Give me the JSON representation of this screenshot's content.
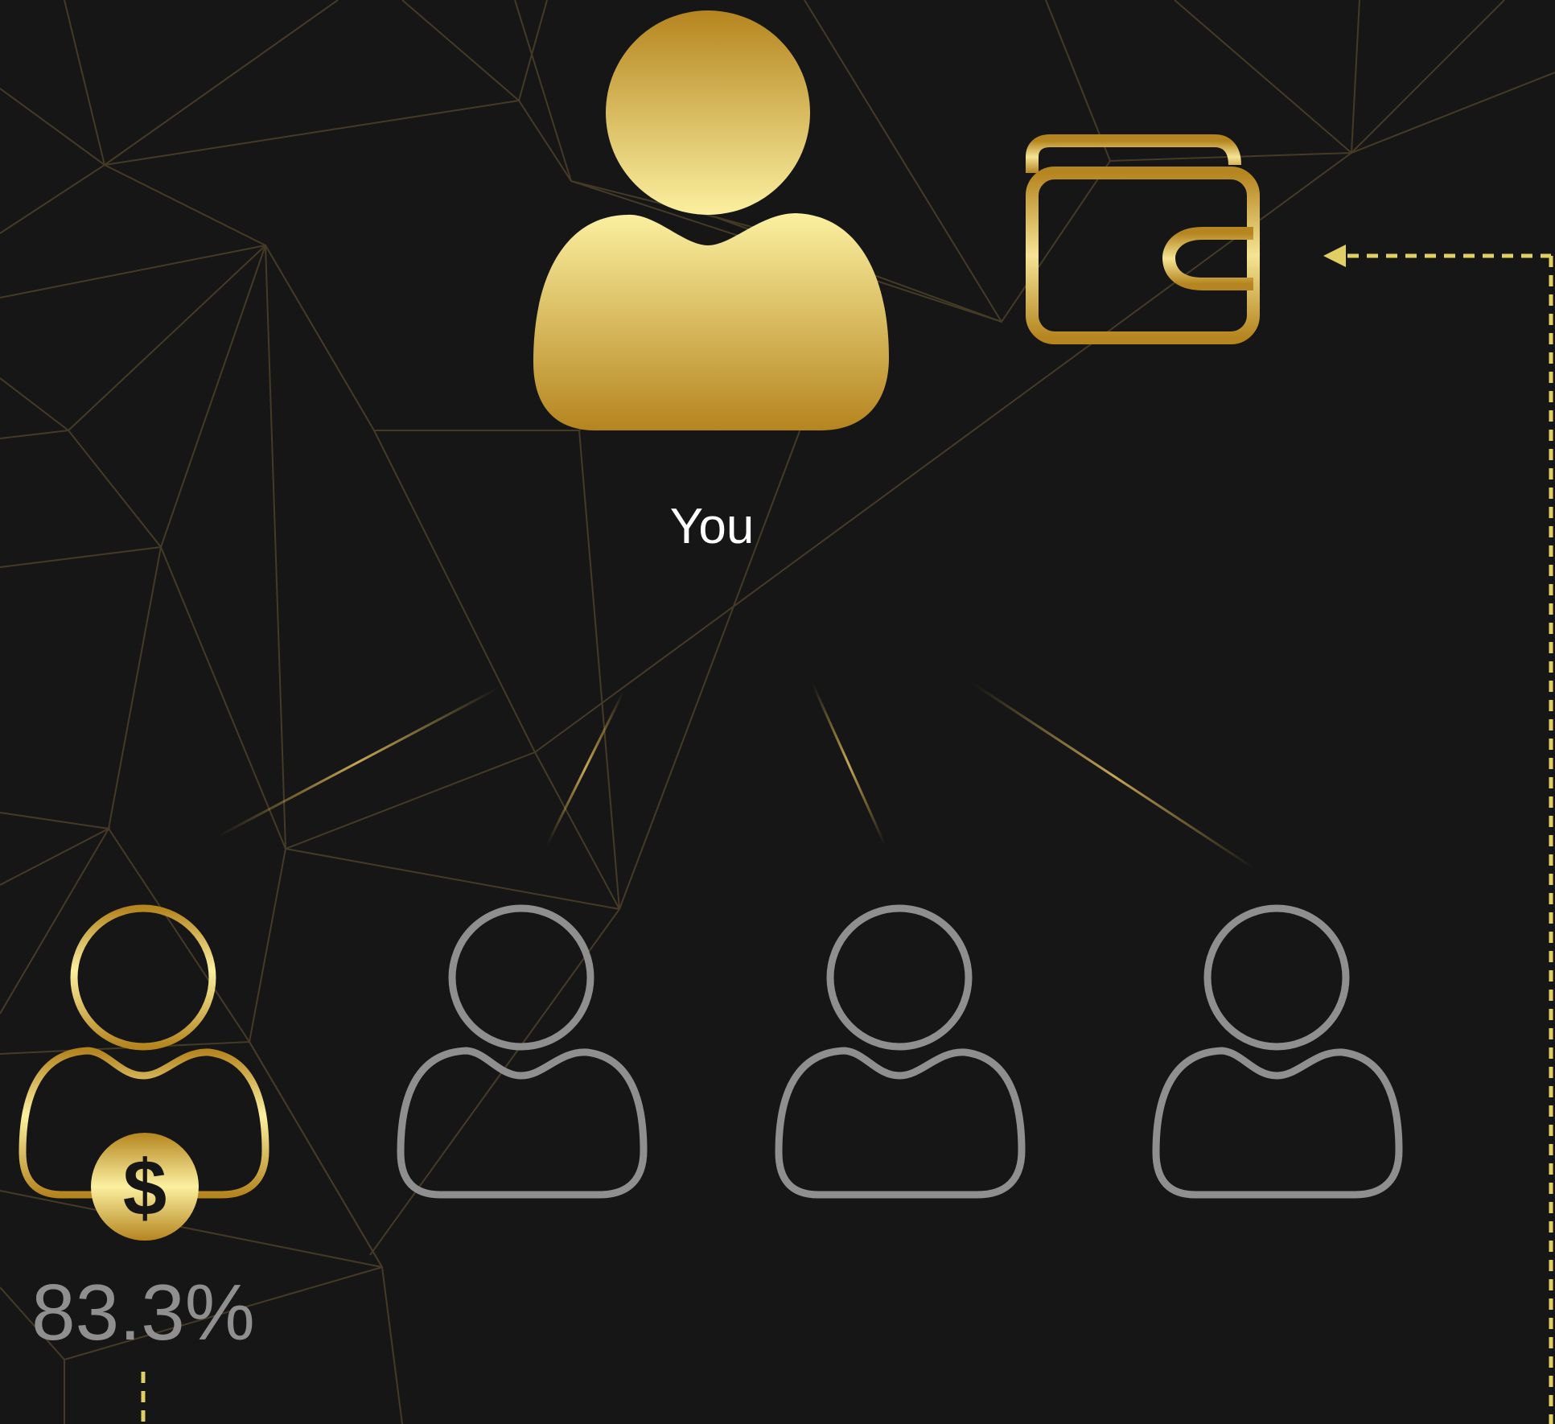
{
  "labels": {
    "you": "You",
    "referral_percent": "83.3%"
  },
  "icons": {
    "main_user": "user-icon",
    "wallet": "wallet-icon",
    "earning_user": "user-dollar-icon",
    "referral_user": "user-outline-icon",
    "dollar": "dollar-icon"
  },
  "colors": {
    "background": "#161616",
    "gold_dark": "#b5851f",
    "gold_light": "#fbf0a0",
    "gray_outline": "#8f8f8f",
    "dashed_line": "#e0cf63",
    "text_white": "#ffffff",
    "text_gray": "#8f8f8f",
    "mesh_line": "#4a3f28"
  },
  "referrals": [
    {
      "state": "earning"
    },
    {
      "state": "empty"
    },
    {
      "state": "empty"
    },
    {
      "state": "empty"
    }
  ]
}
